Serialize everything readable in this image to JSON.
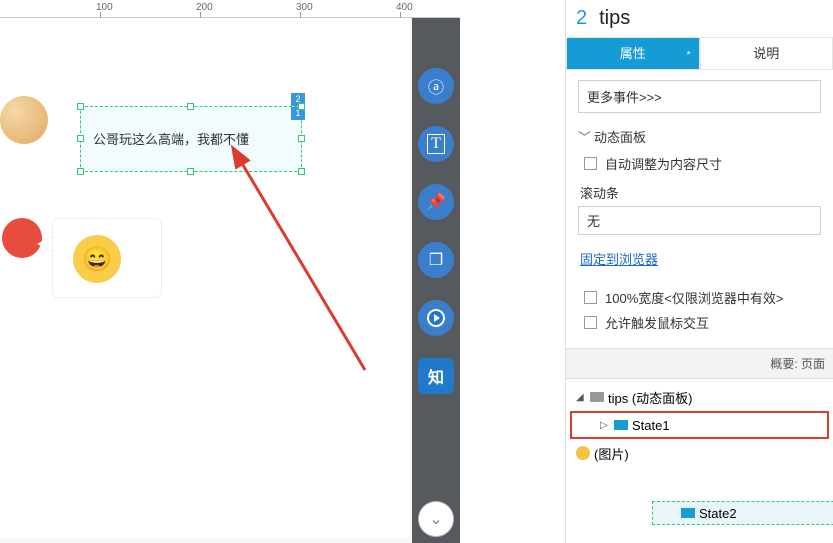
{
  "ruler": {
    "m100": "100",
    "m200": "200",
    "m300": "300",
    "m400": "400"
  },
  "gear_icon": "gear",
  "selection": {
    "text": "公哥玩这么高端，我都不懂",
    "badge_top": "2",
    "badge_bot": "1"
  },
  "toolbar": {
    "search": "ⓐ",
    "text": "T",
    "pin": "📌",
    "copy": "❐",
    "play": "⏵",
    "zhi": "知"
  },
  "panel": {
    "index": "2",
    "name": "tips",
    "tabs": {
      "props": "属性",
      "desc": "说明",
      "star": "*"
    },
    "events": "更多事件>>>",
    "section_dyn": "动态面板",
    "auto_resize": "自动调整为内容尺寸",
    "scroll_label": "滚动条",
    "scroll_value": "无",
    "pin_link": "固定到浏览器",
    "full_width": "100%宽度<仅限浏览器中有效>",
    "allow_mouse": "允许触发鼠标交互",
    "outline_head": "概要: 页面",
    "tree": {
      "root": "tips (动态面板)",
      "state2": "State2",
      "state1": "State1",
      "image": "(图片)"
    }
  }
}
